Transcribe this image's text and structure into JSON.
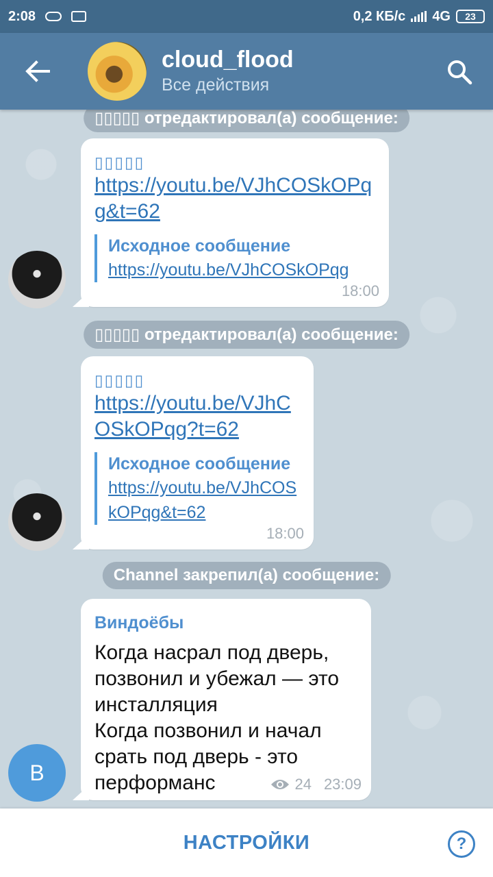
{
  "status_bar": {
    "time": "2:08",
    "speed": "0,2 КБ/с",
    "network": "4G",
    "battery": "23"
  },
  "header": {
    "title": "cloud_flood",
    "subtitle": "Все действия"
  },
  "events": [
    {
      "service": "▯▯▯▯▯ отредактировал(а) сообщение:",
      "author": "▯▯▯▯▯",
      "link": "https://youtu.be/VJhCOSkOPqg&t=62",
      "quote_title": "Исходное сообщение",
      "quote_link": "https://youtu.be/VJhCOSkOPqg",
      "time": "18:00"
    },
    {
      "service": "▯▯▯▯▯ отредактировал(а) сообщение:",
      "author": "▯▯▯▯▯",
      "link": "https://youtu.be/VJhCOSkOPqg?t=62",
      "quote_title": "Исходное сообщение",
      "quote_link": "https://youtu.be/VJhCOSkOPqg&t=62",
      "time": "18:00"
    },
    {
      "service": "Channel закрепил(а) сообщение:",
      "author": "Виндоёбы",
      "avatar_letter": "B",
      "text_lines": [
        "Когда насрал под дверь,",
        "позвонил и убежал — это",
        "инсталляция",
        "Когда позвонил и начал",
        "срать под дверь - это",
        "перформанс"
      ],
      "views": "24",
      "time": "23:09"
    }
  ],
  "bottom": {
    "settings_label": "НАСТРОЙКИ",
    "help_label": "?"
  },
  "colors": {
    "header": "#527da3",
    "statusbar": "#40698a",
    "accent": "#3d82c5",
    "link": "#2f75b8"
  }
}
